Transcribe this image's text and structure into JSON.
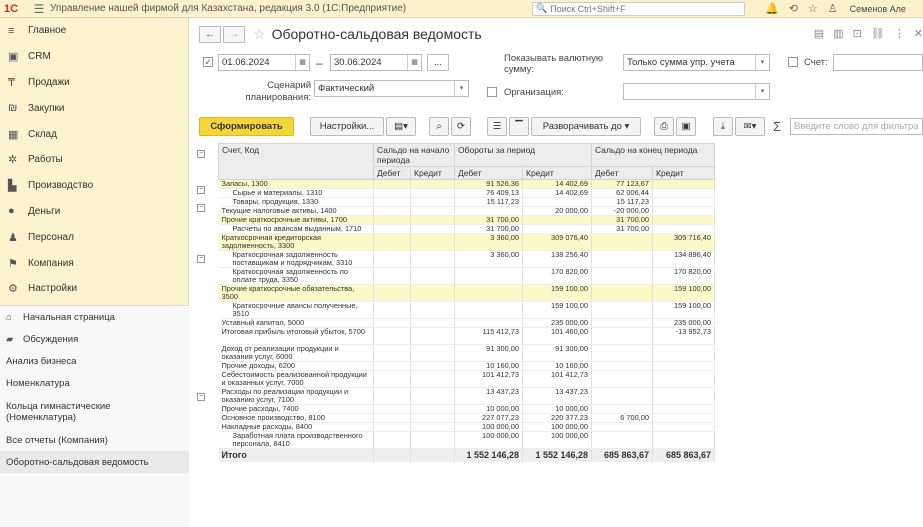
{
  "app": {
    "title": "Управление нашей фирмой для Казахстана, редакция 3.0  (1С:Предприятие)",
    "search_placeholder": "Поиск Ctrl+Shift+F",
    "user": "Семенов Але"
  },
  "sections": [
    {
      "icon": "≡",
      "label": "Главное"
    },
    {
      "icon": "▣",
      "label": "CRM"
    },
    {
      "icon": "₸",
      "label": "Продажи"
    },
    {
      "icon": "₪",
      "label": "Закупки"
    },
    {
      "icon": "▦",
      "label": "Склад"
    },
    {
      "icon": "✲",
      "label": "Работы"
    },
    {
      "icon": "▙",
      "label": "Производство"
    },
    {
      "icon": "●",
      "label": "Деньги"
    },
    {
      "icon": "♟",
      "label": "Персонал"
    },
    {
      "icon": "⚑",
      "label": "Компания"
    },
    {
      "icon": "⚙",
      "label": "Настройки"
    }
  ],
  "nav": [
    {
      "icon": "⌂",
      "label": "Начальная страница"
    },
    {
      "icon": "▰",
      "label": "Обсуждения"
    },
    {
      "icon": "",
      "label": "Анализ бизнеса"
    },
    {
      "icon": "",
      "label": "Номенклатура"
    },
    {
      "icon": "",
      "label": "Кольца гимнастические (Номенклатура)"
    },
    {
      "icon": "",
      "label": "Все отчеты (Компания)"
    },
    {
      "icon": "",
      "label": "Оборотно-сальдовая ведомость"
    }
  ],
  "form": {
    "title": "Оборотно-сальдовая ведомость",
    "date_from": "01.06.2024",
    "date_dash": "–",
    "date_to": "30.06.2024",
    "ellipsis": "...",
    "scenario_label": "Сценарий планирования:",
    "scenario_value": "Фактический",
    "currency_label": "Показывать валютную сумму:",
    "currency_value": "Только сумма упр. учета",
    "org_label": "Организация:",
    "org_value": "",
    "account_label": "Счет:",
    "account_value": ""
  },
  "toolbar": {
    "generate": "Сформировать",
    "settings": "Настройки...",
    "expand": "Разворачивать до",
    "sigma": "Σ",
    "search_placeholder": "Введите слово для фильтра"
  },
  "table": {
    "headers": {
      "account": "Счет, Код",
      "open": "Сальдо на начало периода",
      "turnover": "Обороты за период",
      "close": "Сальдо на конец периода",
      "debit": "Дебет",
      "credit": "Кредит"
    },
    "rows": [
      {
        "name": "Запасы, 1300",
        "level": 0,
        "hl": true,
        "exp": true,
        "od": "",
        "oc": "",
        "td": "91 526,36",
        "tc": "14 402,69",
        "cd": "77 123,67",
        "cc": ""
      },
      {
        "name": "Сырье и материалы, 1310",
        "level": 1,
        "hl": false,
        "exp": false,
        "od": "",
        "oc": "",
        "td": "76 409,13",
        "tc": "14 402,69",
        "cd": "62 006,44",
        "cc": ""
      },
      {
        "name": "Товары, продукция, 1330",
        "level": 1,
        "hl": false,
        "exp": false,
        "od": "",
        "oc": "",
        "td": "15 117,23",
        "tc": "",
        "cd": "15 117,23",
        "cc": ""
      },
      {
        "name": "Текущие налоговые активы, 1400",
        "level": 0,
        "hl": false,
        "exp": false,
        "od": "",
        "oc": "",
        "td": "",
        "tc": "20 000,00",
        "cd": "-20 000,00",
        "cc": ""
      },
      {
        "name": "Прочие краткосрочные активы, 1700",
        "level": 0,
        "hl": true,
        "exp": true,
        "od": "",
        "oc": "",
        "td": "31 700,00",
        "tc": "",
        "cd": "31 700,00",
        "cc": ""
      },
      {
        "name": "Расчеты по авансам выданным, 1710",
        "level": 1,
        "hl": false,
        "exp": false,
        "od": "",
        "oc": "",
        "td": "31 700,00",
        "tc": "",
        "cd": "31 700,00",
        "cc": ""
      },
      {
        "name": "Краткосрочная кредиторская задолженность, 3300",
        "level": 0,
        "hl": true,
        "exp": true,
        "od": "",
        "oc": "",
        "td": "3 360,00",
        "tc": "309 076,40",
        "cd": "",
        "cc": "305 716,40"
      },
      {
        "name": "Краткосрочная задолженность поставщикам и подрядчикам, 3310",
        "level": 1,
        "hl": false,
        "exp": false,
        "od": "",
        "oc": "",
        "td": "3 360,00",
        "tc": "138 256,40",
        "cd": "",
        "cc": "134 896,40"
      },
      {
        "name": "Краткосрочная задолженность по оплате труда, 3350",
        "level": 1,
        "hl": false,
        "exp": false,
        "od": "",
        "oc": "",
        "td": "",
        "tc": "170 820,00",
        "cd": "",
        "cc": "170 820,00"
      },
      {
        "name": "Прочие краткосрочные обязательства, 3500",
        "level": 0,
        "hl": true,
        "exp": true,
        "od": "",
        "oc": "",
        "td": "",
        "tc": "159 100,00",
        "cd": "",
        "cc": "159 100,00"
      },
      {
        "name": "Краткосрочные авансы полученные, 3510",
        "level": 1,
        "hl": false,
        "exp": false,
        "od": "",
        "oc": "",
        "td": "",
        "tc": "159 100,00",
        "cd": "",
        "cc": "159 100,00"
      },
      {
        "name": "Уставный капитал, 5000",
        "level": 0,
        "hl": false,
        "exp": false,
        "od": "",
        "oc": "",
        "td": "",
        "tc": "235 000,00",
        "cd": "",
        "cc": "235 000,00"
      },
      {
        "name": "Итоговая прибыль итоговый убыток, 5700",
        "level": 0,
        "hl": false,
        "exp": false,
        "od": "",
        "oc": "",
        "td": "115 412,73",
        "tc": "101 460,00",
        "cd": "",
        "cc": "-13 952,73"
      },
      {
        "name": "Доход от реализации продукции и оказания услуг, 6000",
        "level": 0,
        "hl": false,
        "exp": false,
        "od": "",
        "oc": "",
        "td": "91 300,00",
        "tc": "91 300,00",
        "cd": "",
        "cc": ""
      },
      {
        "name": "Прочие доходы, 6200",
        "level": 0,
        "hl": false,
        "exp": false,
        "od": "",
        "oc": "",
        "td": "10 160,00",
        "tc": "10 160,00",
        "cd": "",
        "cc": ""
      },
      {
        "name": "Себестоимость реализованной продукции и оказанных услуг, 7000",
        "level": 0,
        "hl": false,
        "exp": false,
        "od": "",
        "oc": "",
        "td": "101 412,73",
        "tc": "101 412,73",
        "cd": "",
        "cc": ""
      },
      {
        "name": "Расходы по реализации продукции и оказанию услуг, 7100",
        "level": 0,
        "hl": false,
        "exp": false,
        "od": "",
        "oc": "",
        "td": "13 437,23",
        "tc": "13 437,23",
        "cd": "",
        "cc": ""
      },
      {
        "name": "Прочие расходы, 7400",
        "level": 0,
        "hl": false,
        "exp": false,
        "od": "",
        "oc": "",
        "td": "10 000,00",
        "tc": "10 000,00",
        "cd": "",
        "cc": ""
      },
      {
        "name": "Основное производство, 8100",
        "level": 0,
        "hl": false,
        "exp": false,
        "od": "",
        "oc": "",
        "td": "227 077,23",
        "tc": "220 377,23",
        "cd": "6 700,00",
        "cc": ""
      },
      {
        "name": "Накладные расходы, 8400",
        "level": 0,
        "hl": false,
        "exp": true,
        "od": "",
        "oc": "",
        "td": "100 000,00",
        "tc": "100 000,00",
        "cd": "",
        "cc": ""
      },
      {
        "name": "Заработная плата производственного персонала, 8410",
        "level": 1,
        "hl": false,
        "exp": false,
        "od": "",
        "oc": "",
        "td": "100 000,00",
        "tc": "100 000,00",
        "cd": "",
        "cc": ""
      }
    ],
    "total": {
      "name": "Итого",
      "td": "1 552 146,28",
      "tc": "1 552 146,28",
      "cd": "685 863,67",
      "cc": "685 863,67"
    }
  }
}
